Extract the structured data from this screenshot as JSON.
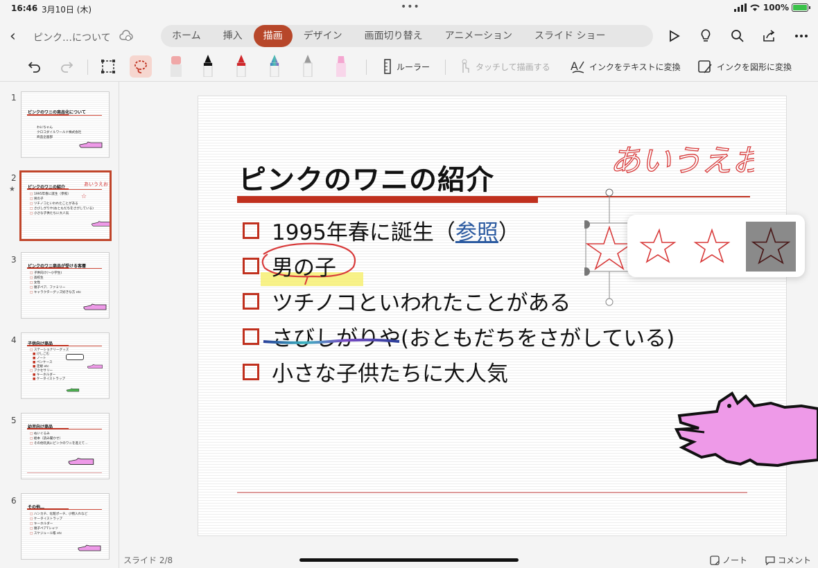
{
  "status": {
    "time": "16:46",
    "date": "3月10日 (木)",
    "battery": "100%"
  },
  "header": {
    "title": "ピンク…について"
  },
  "tabs": [
    "ホーム",
    "挿入",
    "描画",
    "デザイン",
    "画面切り替え",
    "アニメーション",
    "スライド ショー"
  ],
  "active_tab": "描画",
  "ribbon": {
    "ruler": "ルーラー",
    "touch_draw": "タッチして描画する",
    "ink_to_text": "インクをテキストに変換",
    "ink_to_shape": "インクを図形に変換"
  },
  "thumbnails": [
    {
      "num": "1",
      "title": "ピンクのワニの商品化について",
      "items": [
        "わにちゃん",
        "クロコダイルワールド株式会社",
        "商品企画部"
      ]
    },
    {
      "num": "2",
      "title": "ピンクのワニの紹介",
      "items": [
        "1995年春に誕生（参照）",
        "男の子",
        "ツチノコといわれたことがある",
        "さびしがりや(おともだちをさがしている)",
        "小さな子供たちに大人気"
      ],
      "ink": "あいうえお"
    },
    {
      "num": "3",
      "title": "ピンクのワニ商品が受ける客層",
      "items": [
        "子供向け(～小学生)",
        "高校生",
        "女性",
        "親子ペア、ファミリー",
        "キャラクターグッズ好きな方 etc"
      ]
    },
    {
      "num": "4",
      "title": "子供向け商品",
      "items": [
        "ステーショナリーグッズ",
        "けしごむ",
        "ノート",
        "ペンケース",
        "定規 etc",
        "アクセサリー",
        "キーホルダー",
        "ケータイストラップ"
      ]
    },
    {
      "num": "5",
      "title": "幼児向け商品",
      "items": [
        "ぬいぐるみ",
        "絵本（読み聞かせ）",
        "その他玩具にピンクのワニを進えて…"
      ]
    },
    {
      "num": "6",
      "title": "その他…",
      "items": [
        "ハンカチ、化粧ポーチ、小物入れなど",
        "ケータイストラップ",
        "キーホルダー",
        "親子ペアTシャツ",
        "スケジュール帳 etc"
      ]
    }
  ],
  "slide": {
    "title": "ピンクのワニの紹介",
    "bullets": [
      {
        "text": "1995年春に誕生（",
        "link": "参照",
        "after": "）"
      },
      {
        "text": "男の子"
      },
      {
        "text": "ツチノコといわれたことがある"
      },
      {
        "text": "さびしがりや(おともだちをさがしている)"
      },
      {
        "text": "小さな子供たちに大人気"
      }
    ],
    "handwriting": "あいうえお"
  },
  "footer": {
    "slide_count": "スライド 2/8",
    "notes": "ノート",
    "comments": "コメント"
  },
  "colors": {
    "accent": "#b7472a",
    "bullet": "#c0301e",
    "croc": "#ee9ae8"
  }
}
